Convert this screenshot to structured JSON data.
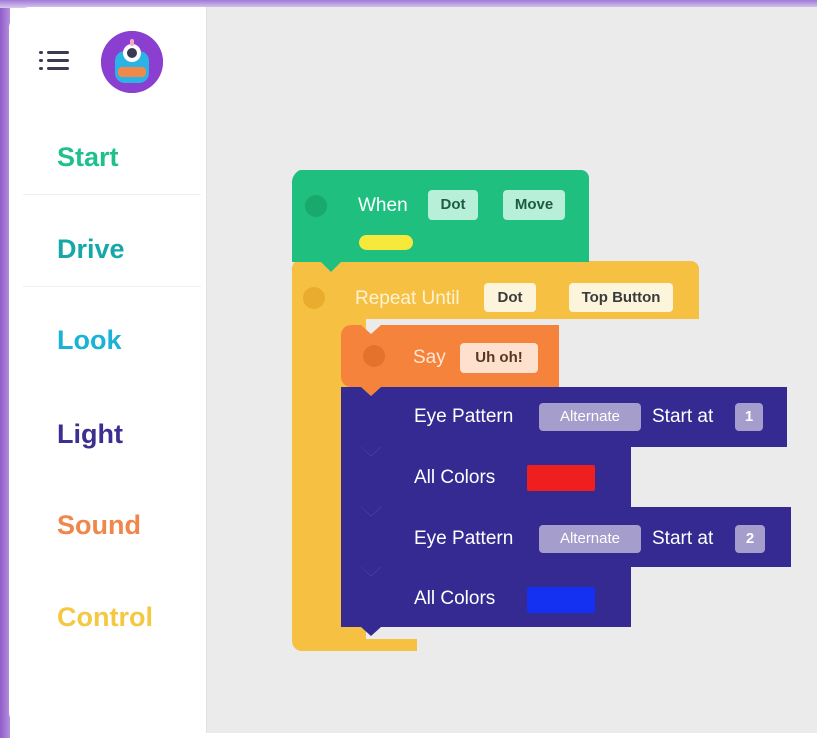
{
  "sidebar": {
    "menu_icon": "hamburger-menu-icon",
    "avatar_icon": "dot-robot-avatar",
    "items": [
      {
        "label": "Start",
        "color": "#20c08e"
      },
      {
        "label": "Drive",
        "color": "#16a8a8"
      },
      {
        "label": "Look",
        "color": "#1ab3d6"
      },
      {
        "label": "Light",
        "color": "#3b2f8f"
      },
      {
        "label": "Sound",
        "color": "#f0864a"
      },
      {
        "label": "Control",
        "color": "#f5c842"
      }
    ]
  },
  "blocks": {
    "when": {
      "label": "When",
      "robot": "Dot",
      "event": "Move",
      "color": "#1fbf7f",
      "swatch_color": "#f6e93b"
    },
    "repeat_until": {
      "label": "Repeat Until",
      "robot": "Dot",
      "condition": "Top Button",
      "color": "#f6c043"
    },
    "say": {
      "label": "Say",
      "value": "Uh oh!",
      "color": "#f5833c"
    },
    "eye_pattern_1": {
      "label": "Eye Pattern",
      "pattern": "Alternate",
      "start_label": "Start at",
      "start_value": "1",
      "color": "#352a92"
    },
    "all_colors_1": {
      "label": "All Colors",
      "swatch_color": "#f01f1f",
      "color": "#352a92"
    },
    "eye_pattern_2": {
      "label": "Eye Pattern",
      "pattern": "Alternate",
      "start_label": "Start at",
      "start_value": "2",
      "color": "#352a92"
    },
    "all_colors_2": {
      "label": "All Colors",
      "swatch_color": "#1430f0",
      "color": "#352a92"
    }
  }
}
